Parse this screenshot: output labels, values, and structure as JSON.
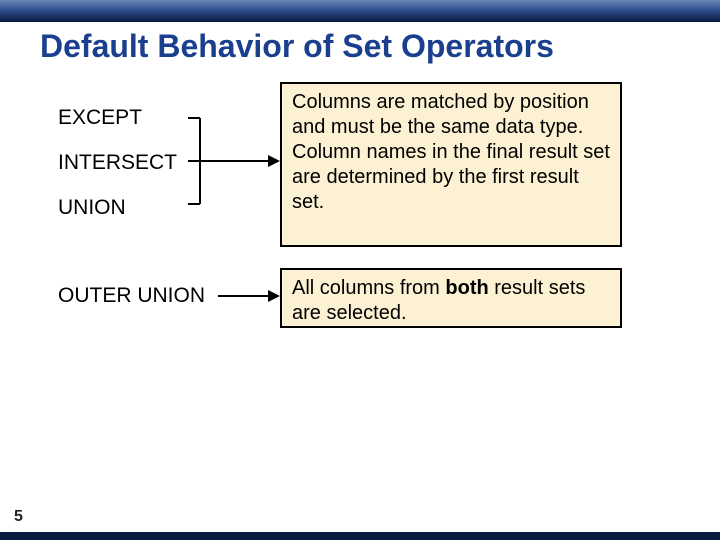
{
  "title": "Default Behavior of Set Operators",
  "page_number": "5",
  "operators": {
    "item1": "EXCEPT",
    "item2": "INTERSECT",
    "item3": "UNION",
    "item4": "OUTER UNION"
  },
  "box1": {
    "line1": "Columns are matched by position and must be the same data type.",
    "line2": "Column names in the final result set are determined by the first result set."
  },
  "box2": {
    "prefix": "All",
    "mid1": " columns from ",
    "bold": "both",
    "mid2": " result sets are selected."
  }
}
